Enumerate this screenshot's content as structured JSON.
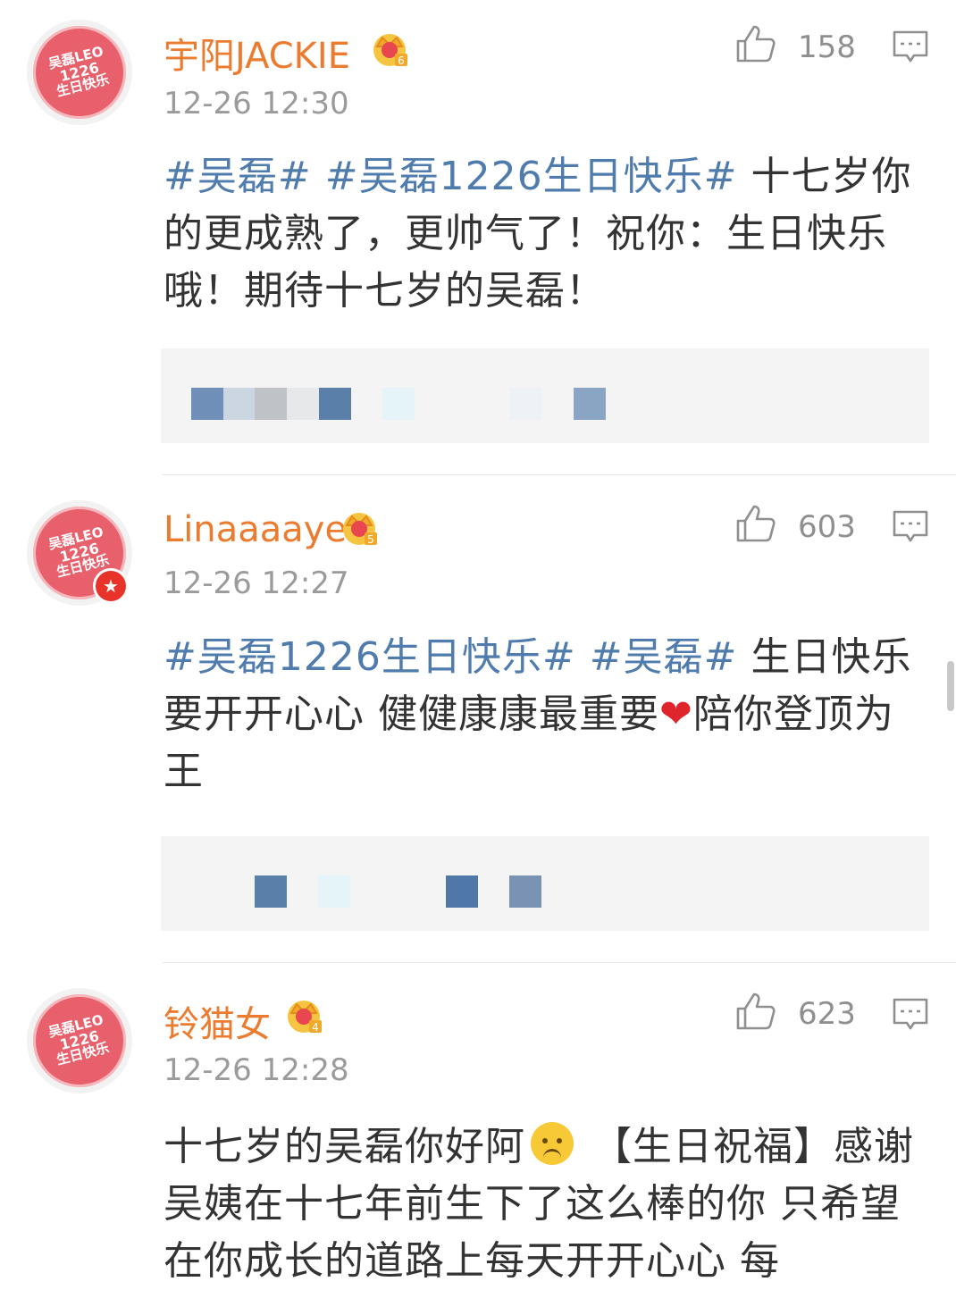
{
  "colors": {
    "username": "#eb7b2f",
    "hashtag": "#4f7bad",
    "text": "#333333",
    "meta": "#9b9b9b",
    "avatar_bg": "#e8606b",
    "verified_badge": "#e8332a"
  },
  "avatar_text": {
    "line1": "吴磊LEO",
    "line2": "1226",
    "line3": "生日快乐"
  },
  "comments": [
    {
      "username": "宇阳JACKIE",
      "level": "6",
      "timestamp": "12-26 12:30",
      "likes": "158",
      "tags": [
        "#吴磊#",
        "#吴磊1226生日快乐#"
      ],
      "text_after_tags": " 十七岁你的更成熟了，更帅气了！祝你：生日快乐哦！期待十七岁的吴磊！",
      "icons": [
        "crown-level-icon",
        "like-icon",
        "reply-icon"
      ]
    },
    {
      "username": "Linaaaaye",
      "level": "5",
      "timestamp": "12-26 12:27",
      "likes": "603",
      "verified": true,
      "tags": [
        "#吴磊1226生日快乐#",
        "#吴磊#"
      ],
      "text_a": " 生日快乐要开开心心 健健康康最重要",
      "heart": "❤",
      "text_b": "陪你登顶为王",
      "icons": [
        "crown-level-icon",
        "like-icon",
        "reply-icon",
        "verified-star-icon"
      ]
    },
    {
      "username": "铃猫女",
      "level": "4",
      "timestamp": "12-26 12:28",
      "likes": "623",
      "text_a": "十七岁的吴磊你好阿",
      "text_b": " 【生日祝福】感谢吴姨在十七年前生下了这么棒的你 只希望在你成长的道路上每天开开心心 每",
      "icons": [
        "crown-level-icon",
        "like-icon",
        "reply-icon",
        "upside-down-face-emoji-icon"
      ]
    }
  ]
}
